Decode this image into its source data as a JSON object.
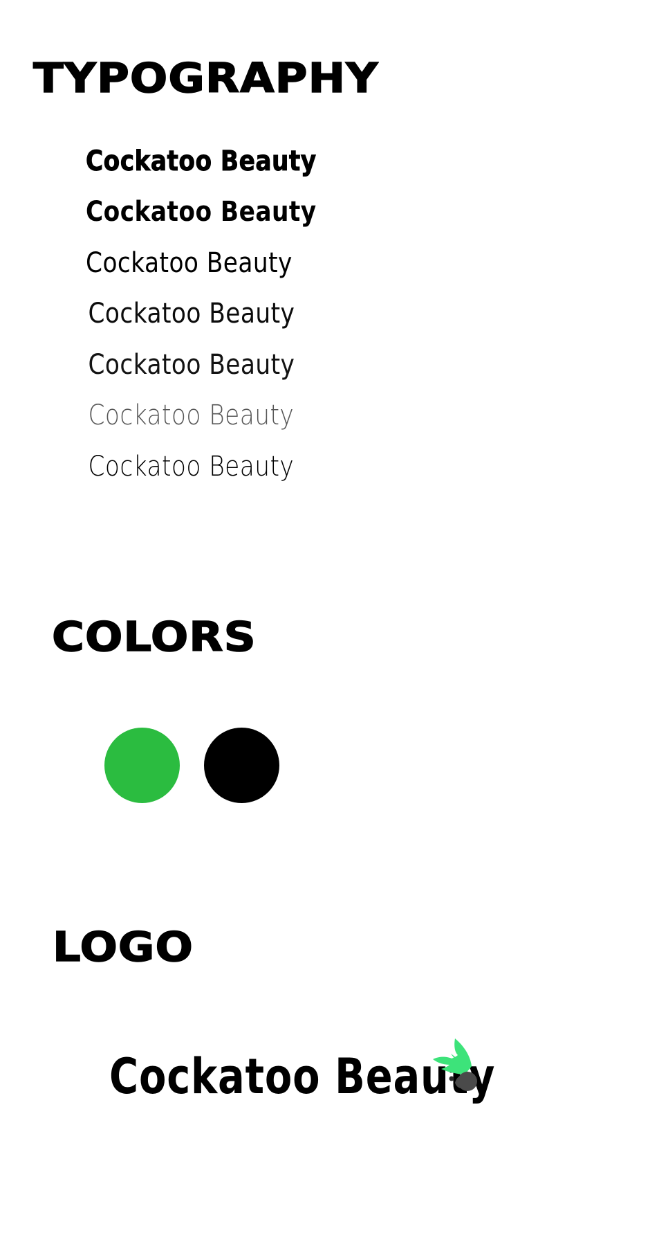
{
  "sections": {
    "typography": {
      "title": "TYPOGRAPHY",
      "samples": [
        "Cockatoo Beauty",
        "Cockatoo Beauty",
        "Cockatoo Beauty",
        "Cockatoo Beauty",
        "Cockatoo Beauty",
        "Cockatoo Beauty",
        "Cockatoo Beauty"
      ]
    },
    "colors": {
      "title": "COLORS",
      "swatches": [
        {
          "color": "#2bbc40"
        },
        {
          "color": "#000000"
        }
      ]
    },
    "logo": {
      "title": "LOGO",
      "wordmark": "Cockatoo Beauty",
      "icon": "cockatoo-icon",
      "crest_color": "#3de37a",
      "head_color": "#4a4a4a"
    }
  }
}
